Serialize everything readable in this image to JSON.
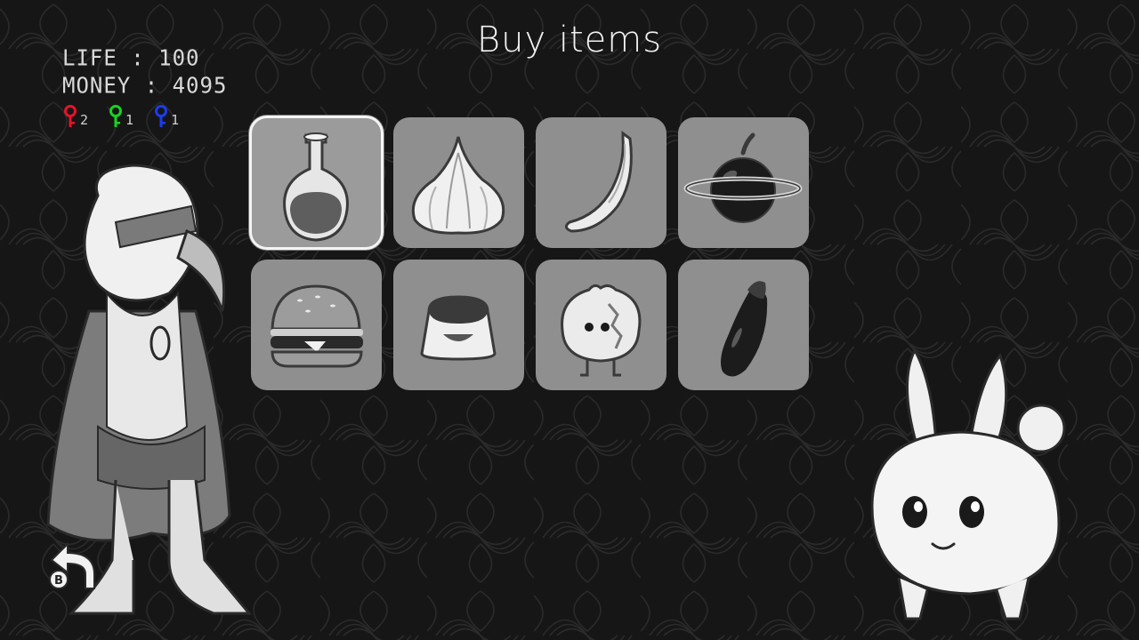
{
  "screen": {
    "title": "Buy items"
  },
  "hud": {
    "life_label": "LIFE : 100",
    "money_label": "MONEY : 4095",
    "keys": [
      {
        "color": "#e3142a",
        "count": "2",
        "icon": "red-key-icon"
      },
      {
        "color": "#18d31f",
        "count": "1",
        "icon": "green-key-icon"
      },
      {
        "color": "#1b3cf0",
        "count": "1",
        "icon": "blue-key-icon"
      }
    ]
  },
  "shop": {
    "selected_index": 0,
    "items": [
      {
        "icon": "potion-icon"
      },
      {
        "icon": "garlic-icon"
      },
      {
        "icon": "banana-icon"
      },
      {
        "icon": "ringed-apple-icon"
      },
      {
        "icon": "hamburger-icon"
      },
      {
        "icon": "pudding-icon"
      },
      {
        "icon": "bun-creature-icon"
      },
      {
        "icon": "eggplant-icon"
      }
    ]
  },
  "controls": {
    "back_button_glyph": "B"
  }
}
